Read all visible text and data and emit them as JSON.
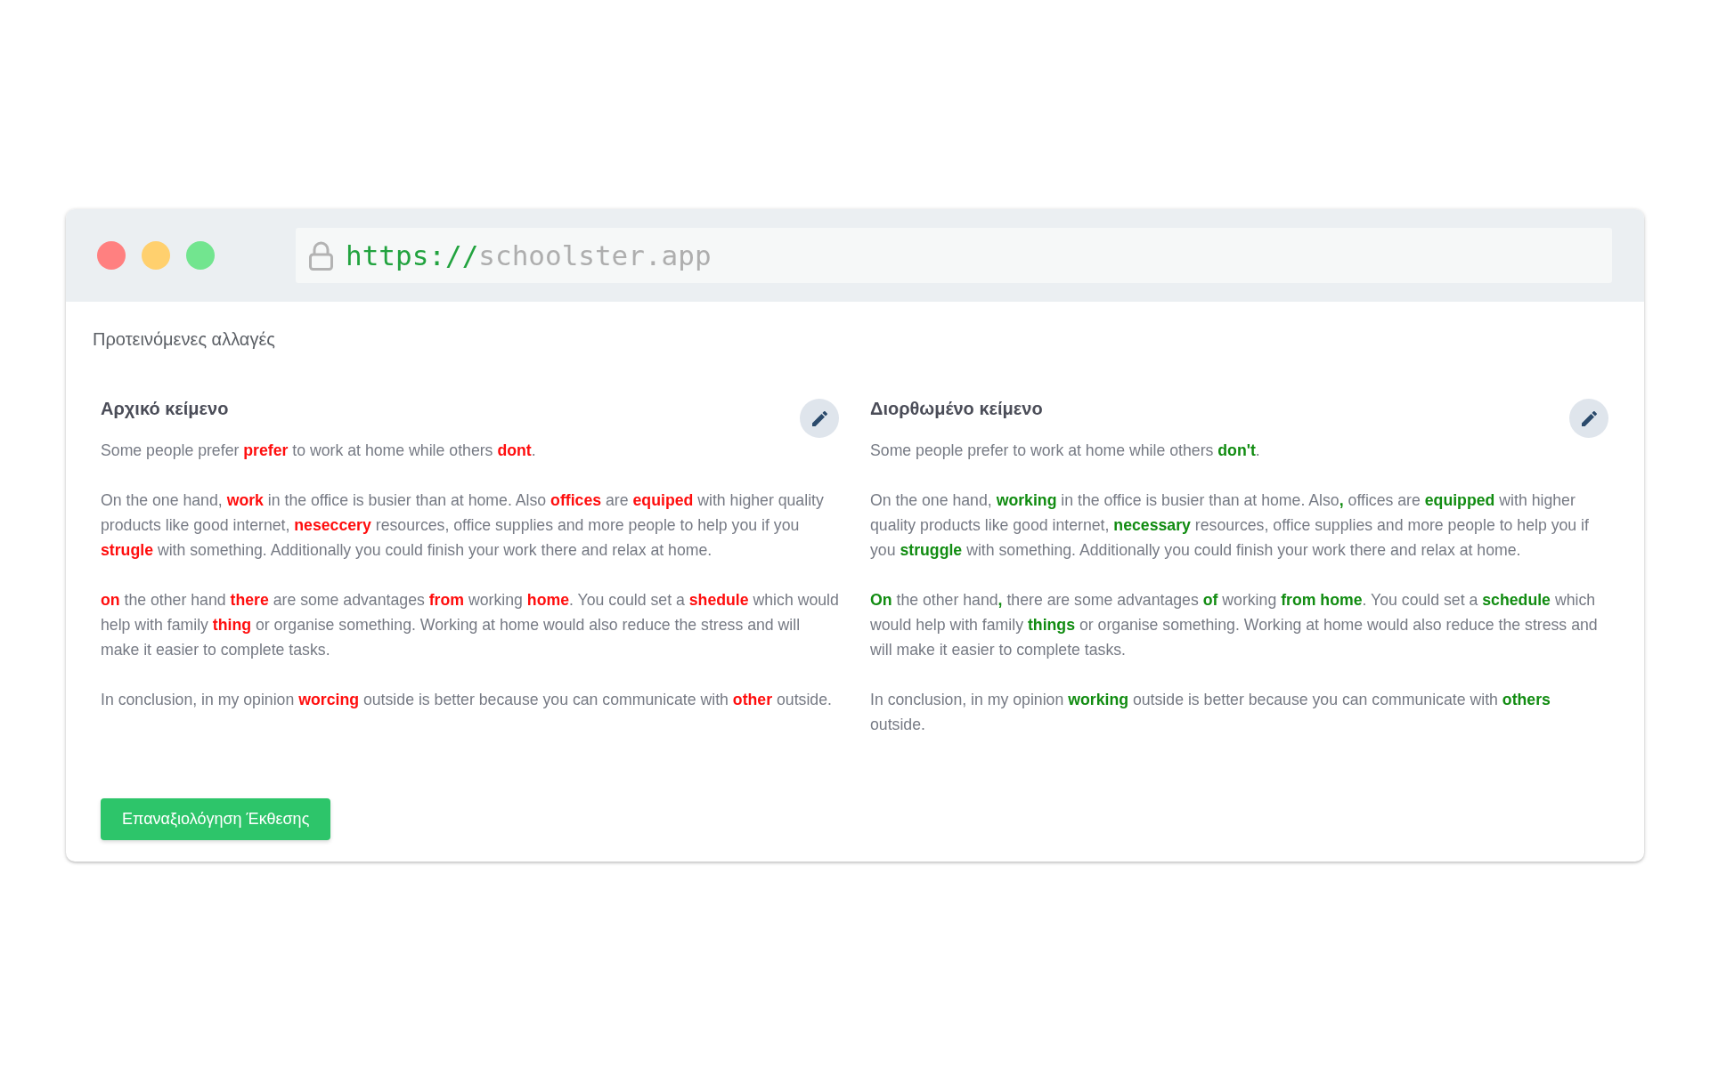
{
  "browser": {
    "url": {
      "scheme": "https://",
      "host": "schoolster.app"
    }
  },
  "page": {
    "title": "Προτεινόμενες αλλαγές"
  },
  "panels": [
    {
      "kind": "original",
      "title": "Αρχικό κείμενο",
      "paragraphs": [
        "Some people prefer **prefer** to work at home while others **dont**.",
        "On the one hand, **work** in the office is busier than at home. Also **offices** are **equiped** with higher quality products like good internet, **neseccery** resources, office supplies and more people to help you if you **strugle** with something. Additionally you could finish your work there and relax at home.",
        "**on** the other hand **there** are some advantages **from** working **home**. You could set a **shedule** which would help with family **thing** or organise something. Working at home would also reduce the stress and will make it easier to complete tasks.",
        "In conclusion, in my opinion **worcing** outside is better because you can communicate with **other** outside."
      ]
    },
    {
      "kind": "corrected",
      "title": "Διορθωμένο κείμενο",
      "paragraphs": [
        "Some people prefer to work at home while others **don't**.",
        "On the one hand, **working** in the office is busier than at home. Also**,** offices are **equipped** with higher quality products like good internet, **necessary** resources, office supplies and more people to help you if you **struggle** with something. Additionally you could finish your work there and relax at home.",
        "**On** the other hand**,** there are some advantages **of** working **from home**. You could set a **schedule** which would help with family **things** or organise something. Working at home would also reduce the stress and will make it easier to complete tasks.",
        "In conclusion, in my opinion **working** outside is better because you can communicate with **others** outside."
      ]
    }
  ],
  "button": {
    "label": "Επαναξιολόγηση Έκθεσης"
  }
}
